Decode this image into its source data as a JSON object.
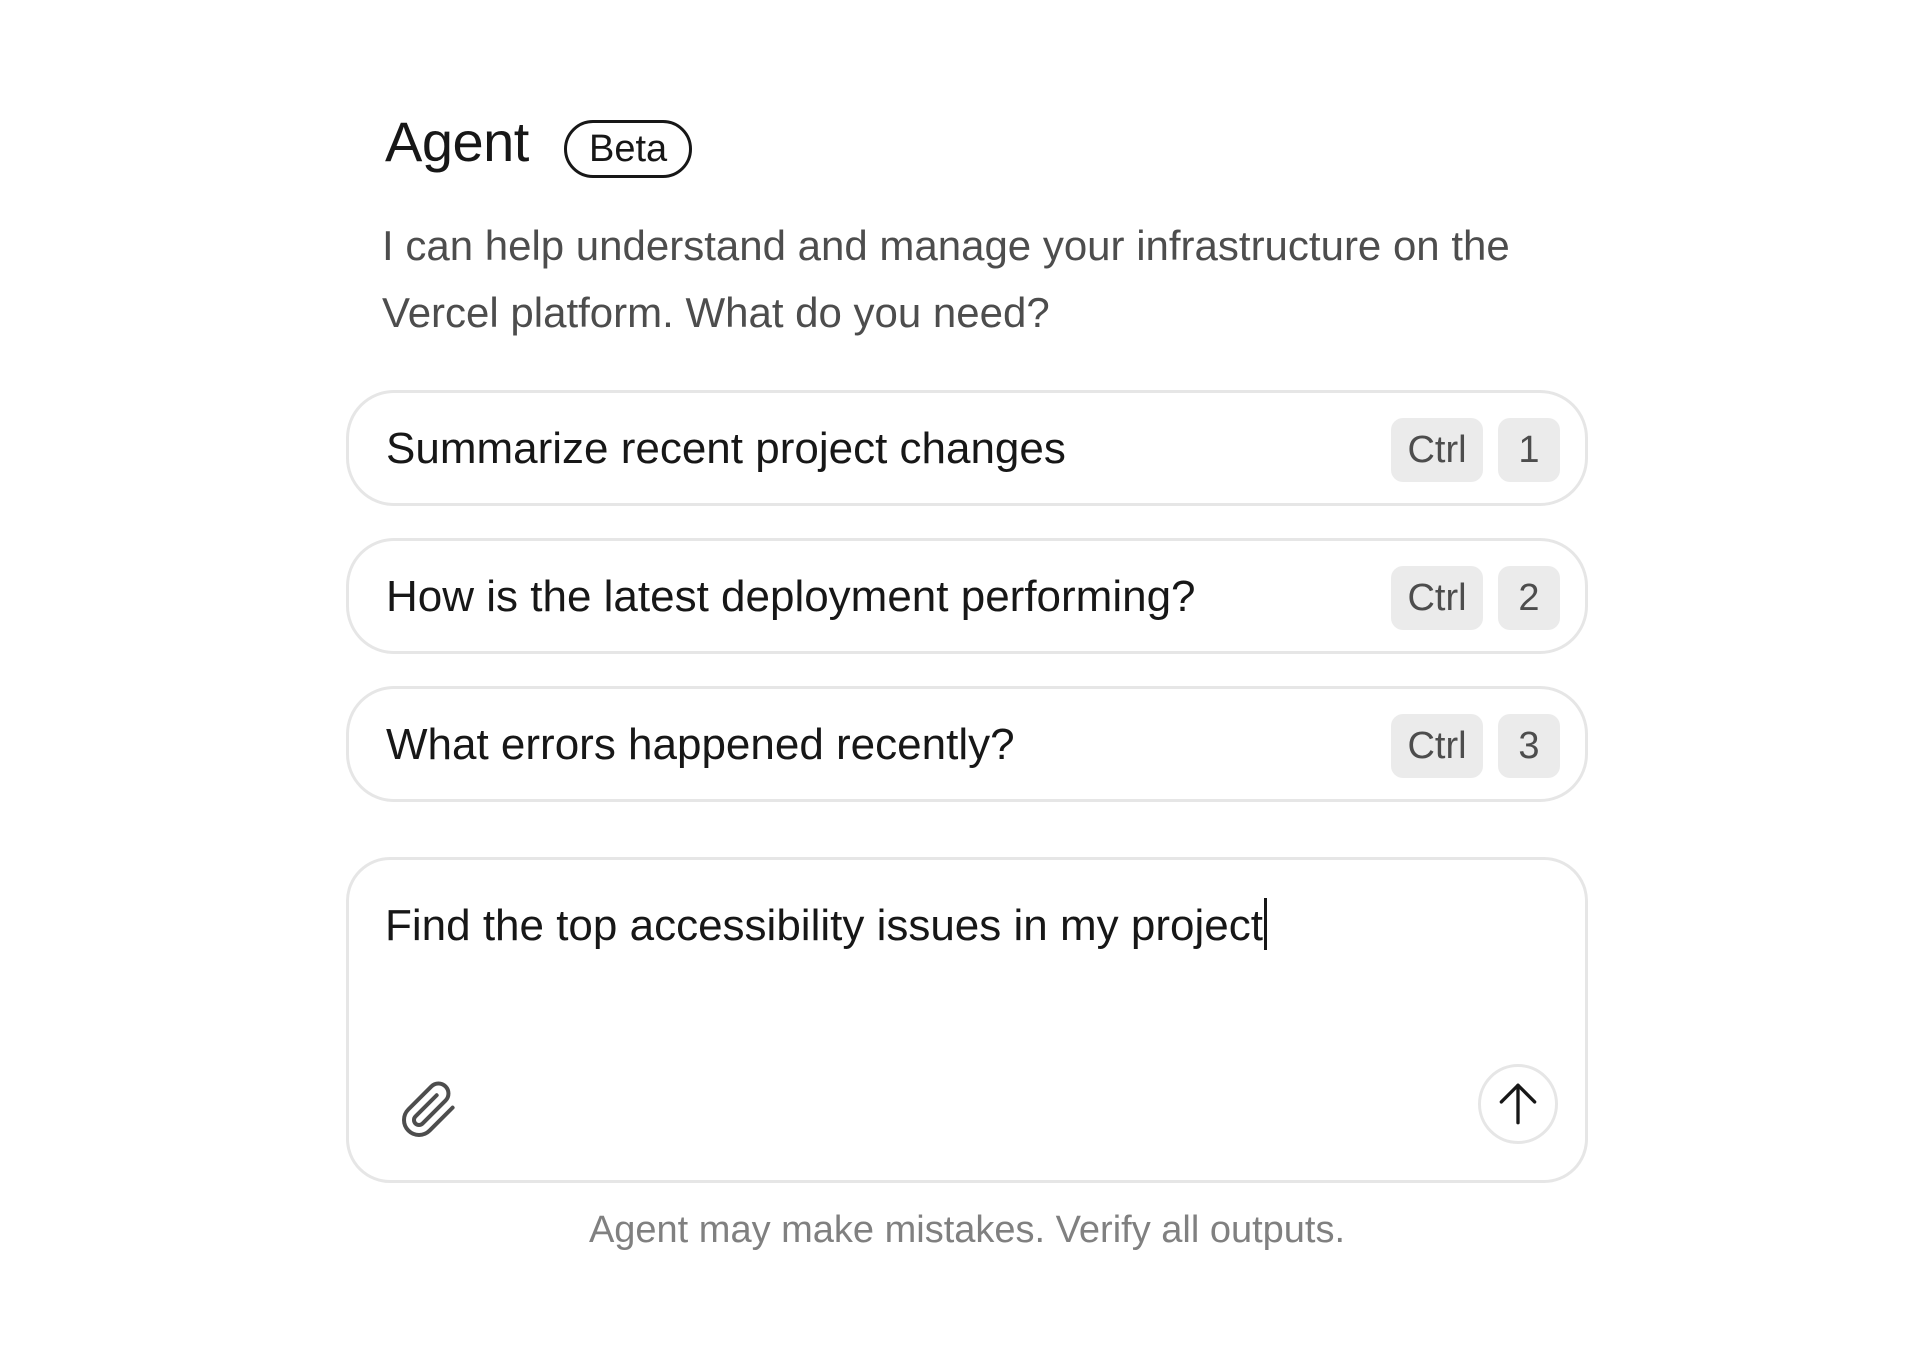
{
  "header": {
    "title": "Agent",
    "badge": "Beta",
    "description": "I can help understand and manage your infrastructure on the Vercel platform. What do you need?"
  },
  "suggestions": [
    {
      "label": "Summarize recent project changes",
      "modifier": "Ctrl",
      "key": "1"
    },
    {
      "label": "How is the latest deployment performing?",
      "modifier": "Ctrl",
      "key": "2"
    },
    {
      "label": "What errors happened recently?",
      "modifier": "Ctrl",
      "key": "3"
    }
  ],
  "composer": {
    "value": "Find the top accessibility issues in my project",
    "attach_icon": "paperclip-icon",
    "send_icon": "arrow-up-icon"
  },
  "footer": {
    "disclaimer": "Agent may make mistakes. Verify all outputs."
  }
}
